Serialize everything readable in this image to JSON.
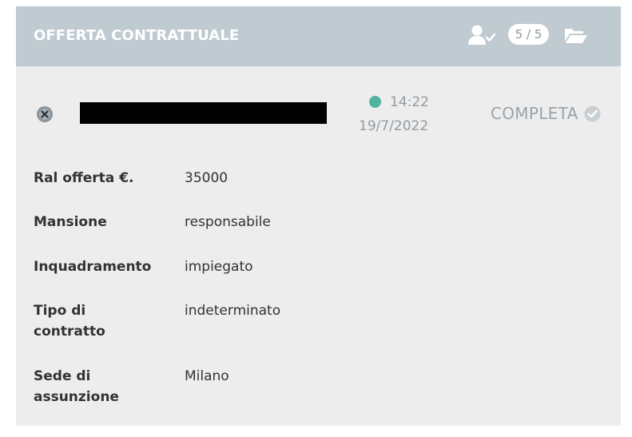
{
  "header": {
    "title": "OFFERTA CONTRATTUALE",
    "count": "5 / 5",
    "user_icon": "user-check-icon",
    "folder_icon": "folder-open-icon"
  },
  "candidate": {
    "remove_icon": "remove-circle-icon",
    "time": "14:22",
    "date": "19/7/2022",
    "status": "COMPLETA",
    "status_dot_color": "#4fb3a0"
  },
  "fields": [
    {
      "label": "Ral offerta €.",
      "value": "35000"
    },
    {
      "label": "Mansione",
      "value": "responsabile"
    },
    {
      "label": "Inquadramento",
      "value": "impiegato"
    },
    {
      "label": "Tipo di\ncontratto",
      "value": "indeterminato"
    },
    {
      "label": "Sede di\nassunzione",
      "value": "Milano"
    }
  ],
  "colors": {
    "header_bg": "#bfcad1",
    "card_bg": "#ededed",
    "accent_green": "#4fb3a0"
  }
}
